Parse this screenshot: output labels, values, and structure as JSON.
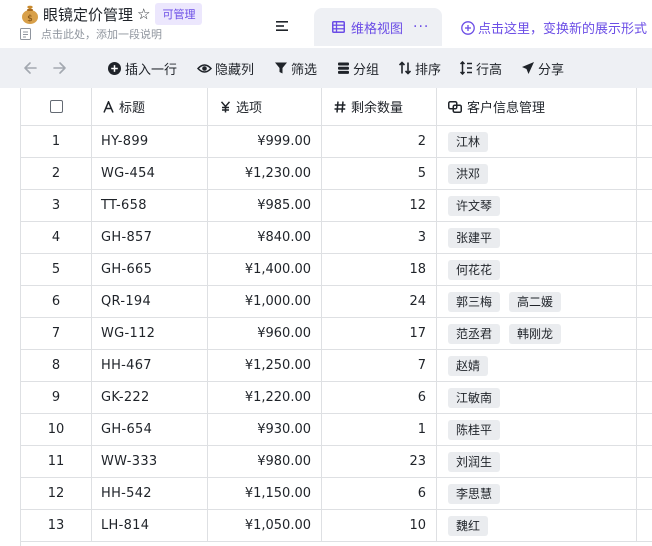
{
  "header": {
    "app_icon": "money-bag-icon",
    "title": "眼镜定价管理",
    "badge": "可管理",
    "description_placeholder": "点击此处，添加一段说明",
    "view_tab_label": "维格视图",
    "view_tab_more": "···",
    "add_view_label": "点击这里，变换新的展示形式"
  },
  "toolbar": {
    "insert_row": "插入一行",
    "hide_columns": "隐藏列",
    "filter": "筛选",
    "group": "分组",
    "sort": "排序",
    "row_height": "行高",
    "share": "分享"
  },
  "table": {
    "columns": [
      "标题",
      "选项",
      "剩余数量",
      "客户信息管理"
    ],
    "rows": [
      {
        "index": "1",
        "title": "HY-899",
        "price": "¥999.00",
        "remaining": "2",
        "customers": [
          "江林"
        ]
      },
      {
        "index": "2",
        "title": "WG-454",
        "price": "¥1,230.00",
        "remaining": "5",
        "customers": [
          "洪邓"
        ]
      },
      {
        "index": "3",
        "title": "TT-658",
        "price": "¥985.00",
        "remaining": "12",
        "customers": [
          "许文琴"
        ]
      },
      {
        "index": "4",
        "title": "GH-857",
        "price": "¥840.00",
        "remaining": "3",
        "customers": [
          "张建平"
        ]
      },
      {
        "index": "5",
        "title": "GH-665",
        "price": "¥1,400.00",
        "remaining": "18",
        "customers": [
          "何花花"
        ]
      },
      {
        "index": "6",
        "title": "QR-194",
        "price": "¥1,000.00",
        "remaining": "24",
        "customers": [
          "郭三梅",
          "高二媛"
        ]
      },
      {
        "index": "7",
        "title": "WG-112",
        "price": "¥960.00",
        "remaining": "17",
        "customers": [
          "范丞君",
          "韩刚龙"
        ]
      },
      {
        "index": "8",
        "title": "HH-467",
        "price": "¥1,250.00",
        "remaining": "7",
        "customers": [
          "赵婧"
        ]
      },
      {
        "index": "9",
        "title": "GK-222",
        "price": "¥1,220.00",
        "remaining": "6",
        "customers": [
          "江敏南"
        ]
      },
      {
        "index": "10",
        "title": "GH-654",
        "price": "¥930.00",
        "remaining": "1",
        "customers": [
          "陈桂平"
        ]
      },
      {
        "index": "11",
        "title": "WW-333",
        "price": "¥980.00",
        "remaining": "23",
        "customers": [
          "刘润生"
        ]
      },
      {
        "index": "12",
        "title": "HH-542",
        "price": "¥1,150.00",
        "remaining": "6",
        "customers": [
          "李思慧"
        ]
      },
      {
        "index": "13",
        "title": "LH-814",
        "price": "¥1,050.00",
        "remaining": "10",
        "customers": [
          "魏红"
        ]
      }
    ]
  },
  "colors": {
    "accent": "#6b4de6",
    "toolbar_bg": "#eef0f4",
    "border": "#dee0e3",
    "tag_bg": "#eaecef"
  }
}
